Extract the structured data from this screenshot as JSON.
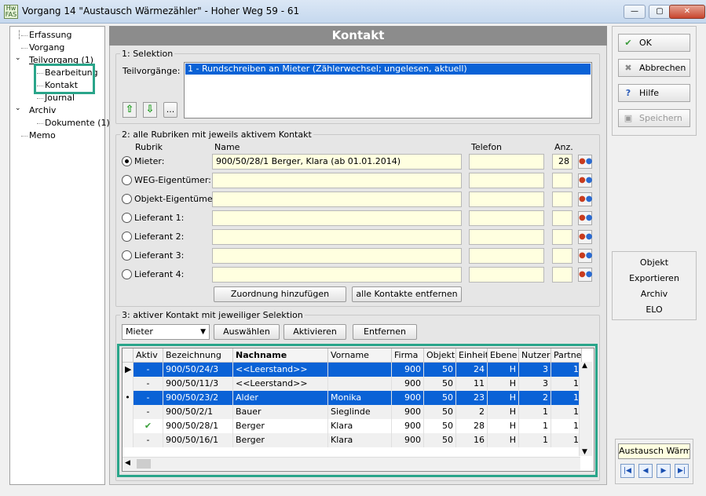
{
  "window": {
    "title": "Vorgang 14 \"Austausch Wärmezähler\" - Hoher Weg 59 - 61",
    "app_icon_text": "Hw\nFAS"
  },
  "tree": [
    {
      "label": "Erfassung",
      "level": 0
    },
    {
      "label": "Vorgang",
      "level": 0
    },
    {
      "label": "Teilvorgang (1)",
      "level": 0
    },
    {
      "label": "Bearbeitung",
      "level": 1
    },
    {
      "label": "Kontakt",
      "level": 1
    },
    {
      "label": "Journal",
      "level": 1
    },
    {
      "label": "Archiv",
      "level": 0
    },
    {
      "label": "Dokumente (1)",
      "level": 1
    },
    {
      "label": "Memo",
      "level": 0
    }
  ],
  "header": {
    "title": "Kontakt"
  },
  "section1": {
    "legend": "1: Selektion",
    "teilvorgaenge_label": "Teilvorgänge:",
    "selected_item": "1 - Rundschreiben an Mieter (Zählerwechsel; ungelesen, aktuell)",
    "more_button": "..."
  },
  "section2": {
    "legend": "2: alle Rubriken mit jeweils aktivem Kontakt",
    "col_rubrik": "Rubrik",
    "col_name": "Name",
    "col_telefon": "Telefon",
    "col_anz": "Anz.",
    "rows": [
      {
        "label": "Mieter:",
        "name": "900/50/28/1  Berger, Klara  (ab 01.01.2014)",
        "telefon": "",
        "anz": "28",
        "checked": true
      },
      {
        "label": "WEG-Eigentümer:",
        "name": "",
        "telefon": "",
        "anz": "",
        "checked": false
      },
      {
        "label": "Objekt-Eigentümer:",
        "name": "",
        "telefon": "",
        "anz": "",
        "checked": false
      },
      {
        "label": "Lieferant 1:",
        "name": "",
        "telefon": "",
        "anz": "",
        "checked": false
      },
      {
        "label": "Lieferant 2:",
        "name": "",
        "telefon": "",
        "anz": "",
        "checked": false
      },
      {
        "label": "Lieferant 3:",
        "name": "",
        "telefon": "",
        "anz": "",
        "checked": false
      },
      {
        "label": "Lieferant 4:",
        "name": "",
        "telefon": "",
        "anz": "",
        "checked": false
      }
    ],
    "btn_add": "Zuordnung hinzufügen",
    "btn_remove_all": "alle Kontakte entfernen"
  },
  "section3": {
    "legend": "3: aktiver Kontakt mit jeweiliger Selektion",
    "dropdown_value": "Mieter",
    "btn_select": "Auswählen",
    "btn_activate": "Aktivieren",
    "btn_remove": "Entfernen"
  },
  "grid": {
    "columns": [
      "Aktiv",
      "Bezeichnung",
      "Nachname",
      "Vorname",
      "Firma",
      "Objekt",
      "Einheit",
      "Ebene",
      "Nutzer",
      "Partne"
    ],
    "rows": [
      {
        "marker": "▶",
        "aktiv": "-",
        "bezeichnung": "900/50/24/3",
        "nachname": "<<Leerstand>>",
        "vorname": "",
        "firma": "900",
        "objekt": "50",
        "einheit": "24",
        "ebene": "H",
        "nutzer": "3",
        "partner": "1",
        "style": "sel"
      },
      {
        "marker": "",
        "aktiv": "-",
        "bezeichnung": "900/50/11/3",
        "nachname": "<<Leerstand>>",
        "vorname": "",
        "firma": "900",
        "objekt": "50",
        "einheit": "11",
        "ebene": "H",
        "nutzer": "3",
        "partner": "1",
        "style": "alt"
      },
      {
        "marker": "•",
        "aktiv": "-",
        "bezeichnung": "900/50/23/2",
        "nachname": "Alder",
        "vorname": "Monika",
        "firma": "900",
        "objekt": "50",
        "einheit": "23",
        "ebene": "H",
        "nutzer": "2",
        "partner": "1",
        "style": "sel"
      },
      {
        "marker": "",
        "aktiv": "-",
        "bezeichnung": "900/50/2/1",
        "nachname": "Bauer",
        "vorname": "Sieglinde",
        "firma": "900",
        "objekt": "50",
        "einheit": "2",
        "ebene": "H",
        "nutzer": "1",
        "partner": "1",
        "style": "alt"
      },
      {
        "marker": "",
        "aktiv": "✔",
        "bezeichnung": "900/50/28/1",
        "nachname": "Berger",
        "vorname": "Klara",
        "firma": "900",
        "objekt": "50",
        "einheit": "28",
        "ebene": "H",
        "nutzer": "1",
        "partner": "1",
        "style": "norm"
      },
      {
        "marker": "",
        "aktiv": "-",
        "bezeichnung": "900/50/16/1",
        "nachname": "Berger",
        "vorname": "Klara",
        "firma": "900",
        "objekt": "50",
        "einheit": "16",
        "ebene": "H",
        "nutzer": "1",
        "partner": "1",
        "style": "alt"
      }
    ]
  },
  "right": {
    "ok": "OK",
    "abbrechen": "Abbrechen",
    "hilfe": "Hilfe",
    "speichern": "Speichern",
    "links": [
      "Objekt",
      "Exportieren",
      "Archiv",
      "ELO"
    ],
    "austausch": "Austausch Wärme"
  },
  "colors": {
    "accent": "#2aa58a",
    "selection": "#0a62d6",
    "field": "#ffffe0"
  }
}
